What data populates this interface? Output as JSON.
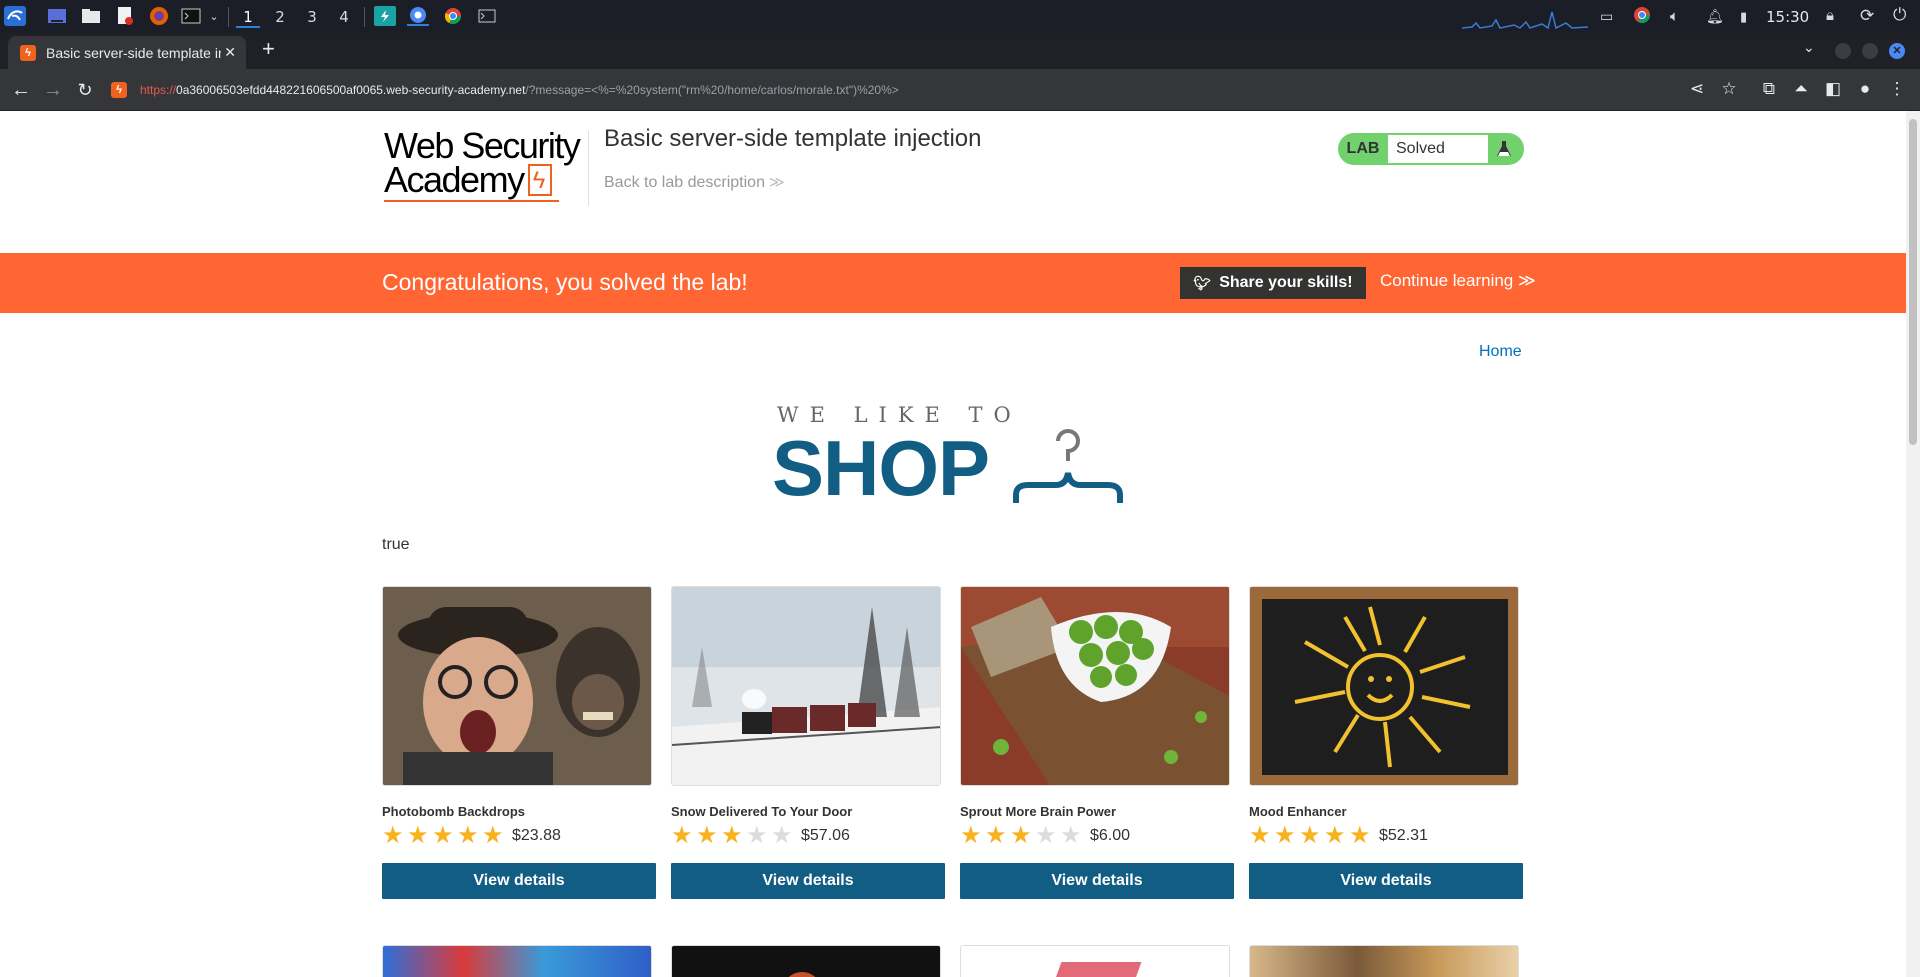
{
  "taskbar": {
    "workspaces": [
      "1",
      "2",
      "3",
      "4"
    ],
    "active_workspace": "1",
    "clock": "15:30"
  },
  "browser": {
    "tab_title": "Basic server-side template injection",
    "url_proto": "https://",
    "url_host": "0a36006503efdd448221606500af0065.web-security-academy.net",
    "url_rest": "/?message=<%=%20system(\"rm%20/home/carlos/morale.txt\")%20%>"
  },
  "header": {
    "logo_line1": "Web Security",
    "logo_line2": "Academy",
    "lab_title": "Basic server-side template injection",
    "back_link": "Back to lab description",
    "lab_label": "LAB",
    "lab_status": "Solved"
  },
  "banner": {
    "congrats": "Congratulations, you solved the lab!",
    "share": "Share your skills!",
    "continue": "Continue learning"
  },
  "nav": {
    "home": "Home"
  },
  "shop_logo": {
    "small": "WE LIKE TO",
    "big": "SHOP"
  },
  "message": "true",
  "products": [
    {
      "name": "Photobomb Backdrops",
      "rating": 5,
      "price": "$23.88",
      "button": "View details"
    },
    {
      "name": "Snow Delivered To Your Door",
      "rating": 3,
      "price": "$57.06",
      "button": "View details"
    },
    {
      "name": "Sprout More Brain Power",
      "rating": 3,
      "price": "$6.00",
      "button": "View details"
    },
    {
      "name": "Mood Enhancer",
      "rating": 5,
      "price": "$52.31",
      "button": "View details"
    }
  ],
  "colors": {
    "brand_orange": "#ff6633",
    "shop_blue": "#125d84",
    "lab_green": "#70d16d",
    "star": "#f7b21e"
  }
}
